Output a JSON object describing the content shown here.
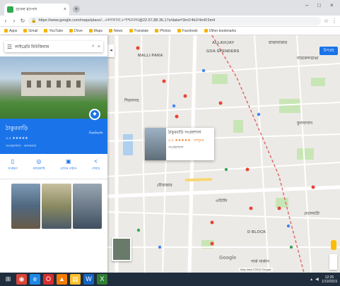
{
  "browser": {
    "tab_title": "গুগল ম্যাপস",
    "tab_close": "×",
    "new_tab": "+",
    "window_min": "–",
    "window_max": "□",
    "window_close": "×",
    "url": "https://www.google.com/maps/place/...+কলকাতা,+পশ্চিমবঙ্গ/@22.57,88.36,17z/data=!3m1!4b1!4m5!3m4"
  },
  "bookmarks": [
    "Apps",
    "Gmail",
    "YouTube",
    "Drive",
    "Maps",
    "News",
    "Translate",
    "Photos",
    "Facebook",
    "Other bookmarks"
  ],
  "search": {
    "value": "লাইব্রেরি মিউজিয়াম"
  },
  "place": {
    "name": "ঠাকুরবাড়ি",
    "rating_text": "৪.৫ ★★★★★",
    "address": "সংগ্রহশালা · কলকাতা",
    "directions_label": "দিকনির্দেশ",
    "directions_icon": "diamond-arrow-icon"
  },
  "actions": [
    {
      "label": "সংরক্ষণ",
      "icon": "save-icon",
      "glyph": "▯"
    },
    {
      "label": "কাছাকাছি",
      "icon": "nearby-icon",
      "glyph": "◎"
    },
    {
      "label": "ফোনে পাঠান",
      "icon": "phone-icon",
      "glyph": "▣"
    },
    {
      "label": "শেয়ার",
      "icon": "share-icon",
      "glyph": "<"
    }
  ],
  "map": {
    "satellite_label": "উপগ্রহ",
    "labels": [
      {
        "text": "ALLAVIJAY",
        "id": "label-allavijay"
      },
      {
        "text": "GOA SPENDERS",
        "id": "label-goa"
      },
      {
        "text": "MALLI PARA",
        "id": "label-mallipara"
      },
      {
        "text": "রাজাবাজার",
        "id": "label-rajabazar"
      },
      {
        "text": "নারকেলডাঙা",
        "id": "label-narkel"
      },
      {
        "text": "শিয়ালদহ",
        "id": "label-sealdah"
      },
      {
        "text": "বৌবাজার",
        "id": "label-bowbazar"
      },
      {
        "text": "ফুলবাগান",
        "id": "label-phoolbagan"
      },
      {
        "text": "বেলেঘাটা",
        "id": "label-beleghata"
      },
      {
        "text": "D BLOCK",
        "id": "label-dblock"
      },
      {
        "text": "এন্টালি",
        "id": "label-entally"
      },
      {
        "text": "পার্ক সার্কাস",
        "id": "label-park"
      }
    ],
    "card": {
      "name": "ঠাকুরবাড়ি সংগ্রহশালা",
      "rating": "৪.৫ ★★★★★ · জাদুঘর",
      "category": "সংগ্রহশালা"
    },
    "copyright": "Map data ©2019 Google",
    "google_logo": "Google"
  },
  "taskbar": {
    "apps": [
      {
        "name": "start-icon",
        "glyph": "⊞",
        "color": "#1f2d3d"
      },
      {
        "name": "chrome-icon",
        "glyph": "◉",
        "color": "#db4437"
      },
      {
        "name": "ie-icon",
        "glyph": "e",
        "color": "#1e88e5"
      },
      {
        "name": "opera-icon",
        "glyph": "O",
        "color": "#d32f2f"
      },
      {
        "name": "vlc-icon",
        "glyph": "▲",
        "color": "#f57c00"
      },
      {
        "name": "explorer-icon",
        "glyph": "▤",
        "color": "#fbc02d"
      },
      {
        "name": "word-icon",
        "glyph": "W",
        "color": "#1565c0"
      },
      {
        "name": "excel-icon",
        "glyph": "X",
        "color": "#2e7d32"
      }
    ],
    "time": "12:26",
    "date": "1/10/2019"
  }
}
